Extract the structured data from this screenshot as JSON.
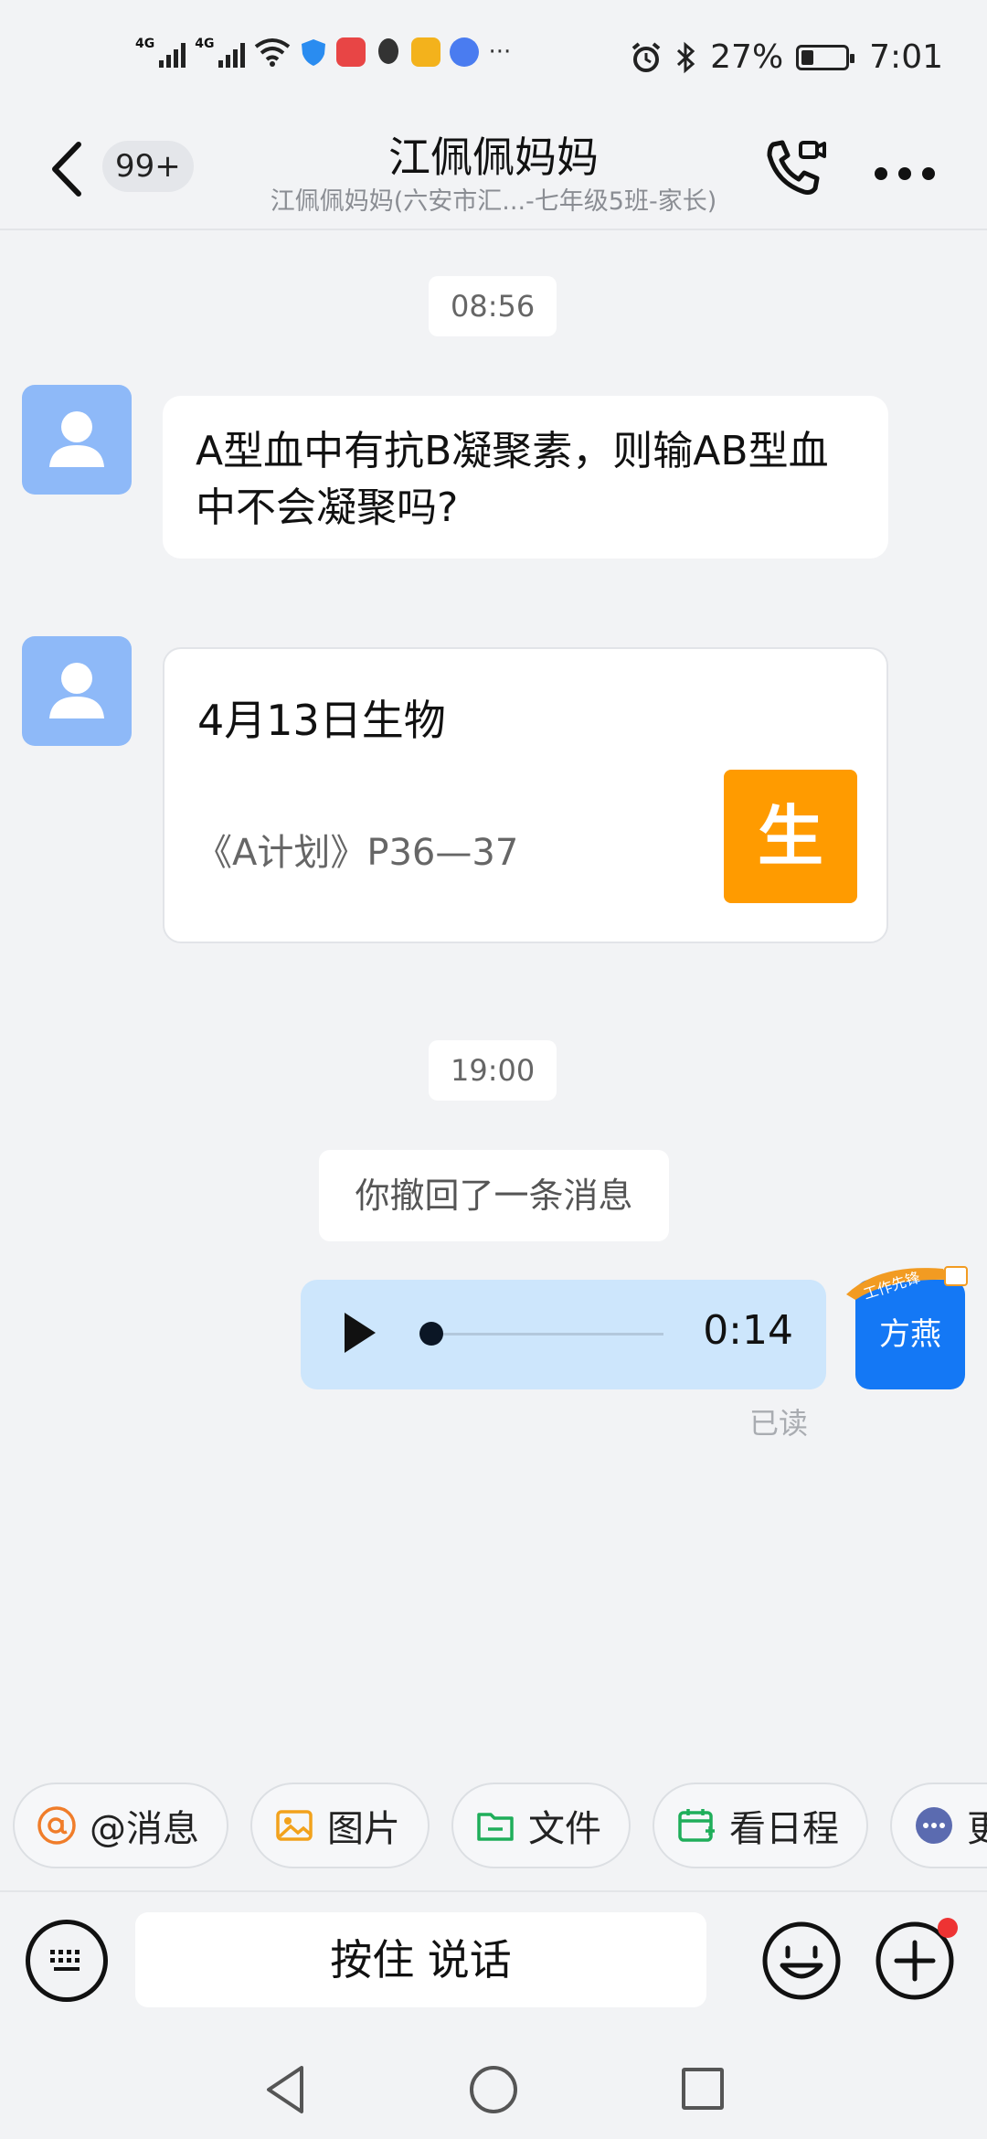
{
  "status_bar": {
    "network_1": "4G",
    "network_2": "4G",
    "more_dots": "···",
    "battery_percent": "27%",
    "battery_level": 0.27,
    "time": "7:01"
  },
  "header": {
    "unread_badge": "99+",
    "title": "江佩佩妈妈",
    "subtitle": "江佩佩妈妈(六安市汇...-七年级5班-家长)"
  },
  "messages": {
    "time_1": "08:56",
    "text_1": "A型血中有抗B凝聚素，则输AB型血中不会凝聚吗?",
    "card_title": "4月13日生物",
    "card_desc": "《A计划》P36—37",
    "card_icon_char": "生",
    "time_2": "19:00",
    "recall_notice": "你撤回了一条消息",
    "voice_duration": "0:14",
    "voice_progress": 0.0,
    "my_avatar_name": "方燕",
    "avatar_ribbon": "工作先锋",
    "read_status": "已读"
  },
  "quick_actions": [
    {
      "label": "@消息",
      "icon": "at-icon"
    },
    {
      "label": "图片",
      "icon": "image-icon"
    },
    {
      "label": "文件",
      "icon": "folder-icon"
    },
    {
      "label": "看日程",
      "icon": "calendar-add-icon"
    },
    {
      "label": "更",
      "icon": "more-circle-icon"
    }
  ],
  "input_bar": {
    "hold_to_talk": "按住 说话"
  },
  "colors": {
    "accent_blue": "#1478f5",
    "voice_bubble": "#cde6fc",
    "card_icon_orange": "#ff9b00",
    "avatar_placeholder": "#8eb9f8"
  }
}
